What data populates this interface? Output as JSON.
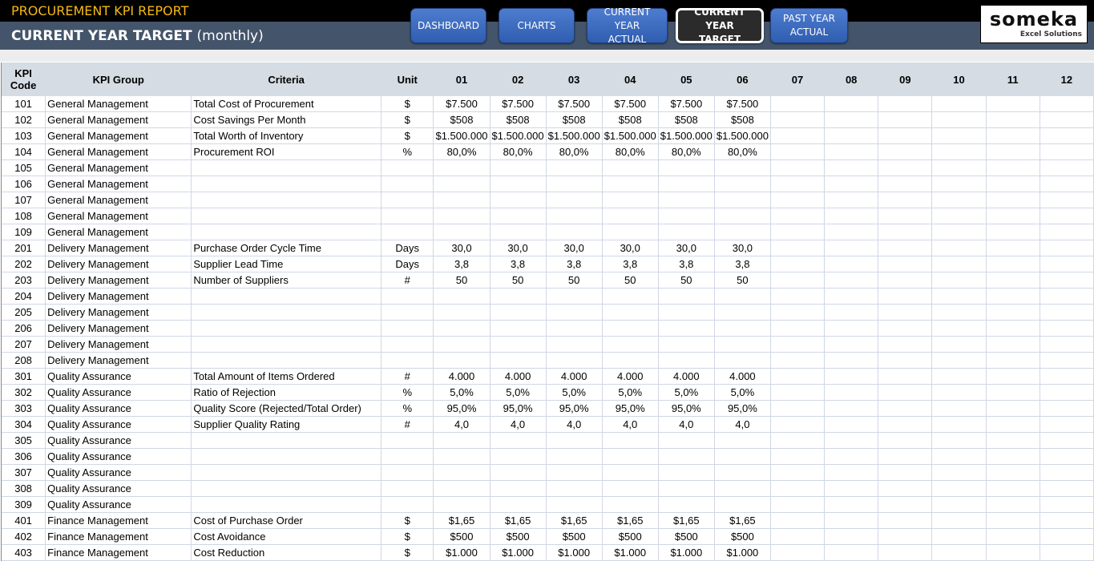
{
  "header": {
    "app_title": "PROCUREMENT KPI REPORT",
    "page_title": "CURRENT YEAR TARGET",
    "page_subtitle": "(monthly)"
  },
  "nav": {
    "dashboard": "DASHBOARD",
    "charts": "CHARTS",
    "current_actual_1": "CURRENT YEAR",
    "current_actual_2": "ACTUAL",
    "current_target_1": "CURRENT YEAR",
    "current_target_2": "TARGET",
    "past_actual_1": "PAST YEAR",
    "past_actual_2": "ACTUAL"
  },
  "logo": {
    "word": "someka",
    "sub": "Excel Solutions"
  },
  "table": {
    "headers": {
      "code_1": "KPI",
      "code_2": "Code",
      "group": "KPI Group",
      "criteria": "Criteria",
      "unit": "Unit",
      "months": [
        "01",
        "02",
        "03",
        "04",
        "05",
        "06",
        "07",
        "08",
        "09",
        "10",
        "11",
        "12"
      ]
    },
    "rows": [
      {
        "code": "101",
        "group": "General Management",
        "criteria": "Total Cost of Procurement",
        "unit": "$",
        "values": [
          "$7.500",
          "$7.500",
          "$7.500",
          "$7.500",
          "$7.500",
          "$7.500",
          "",
          "",
          "",
          "",
          "",
          ""
        ]
      },
      {
        "code": "102",
        "group": "General Management",
        "criteria": "Cost Savings Per Month",
        "unit": "$",
        "values": [
          "$508",
          "$508",
          "$508",
          "$508",
          "$508",
          "$508",
          "",
          "",
          "",
          "",
          "",
          ""
        ]
      },
      {
        "code": "103",
        "group": "General Management",
        "criteria": "Total Worth of Inventory",
        "unit": "$",
        "values": [
          "$1.500.000",
          "$1.500.000",
          "$1.500.000",
          "$1.500.000",
          "$1.500.000",
          "$1.500.000",
          "",
          "",
          "",
          "",
          "",
          ""
        ]
      },
      {
        "code": "104",
        "group": "General Management",
        "criteria": "Procurement ROI",
        "unit": "%",
        "values": [
          "80,0%",
          "80,0%",
          "80,0%",
          "80,0%",
          "80,0%",
          "80,0%",
          "",
          "",
          "",
          "",
          "",
          ""
        ]
      },
      {
        "code": "105",
        "group": "General Management",
        "criteria": "",
        "unit": "",
        "values": [
          "",
          "",
          "",
          "",
          "",
          "",
          "",
          "",
          "",
          "",
          "",
          ""
        ]
      },
      {
        "code": "106",
        "group": "General Management",
        "criteria": "",
        "unit": "",
        "values": [
          "",
          "",
          "",
          "",
          "",
          "",
          "",
          "",
          "",
          "",
          "",
          ""
        ]
      },
      {
        "code": "107",
        "group": "General Management",
        "criteria": "",
        "unit": "",
        "values": [
          "",
          "",
          "",
          "",
          "",
          "",
          "",
          "",
          "",
          "",
          "",
          ""
        ]
      },
      {
        "code": "108",
        "group": "General Management",
        "criteria": "",
        "unit": "",
        "values": [
          "",
          "",
          "",
          "",
          "",
          "",
          "",
          "",
          "",
          "",
          "",
          ""
        ]
      },
      {
        "code": "109",
        "group": "General Management",
        "criteria": "",
        "unit": "",
        "values": [
          "",
          "",
          "",
          "",
          "",
          "",
          "",
          "",
          "",
          "",
          "",
          ""
        ]
      },
      {
        "code": "201",
        "group": "Delivery Management",
        "criteria": "Purchase Order Cycle Time",
        "unit": "Days",
        "values": [
          "30,0",
          "30,0",
          "30,0",
          "30,0",
          "30,0",
          "30,0",
          "",
          "",
          "",
          "",
          "",
          ""
        ]
      },
      {
        "code": "202",
        "group": "Delivery Management",
        "criteria": "Supplier Lead Time",
        "unit": "Days",
        "values": [
          "3,8",
          "3,8",
          "3,8",
          "3,8",
          "3,8",
          "3,8",
          "",
          "",
          "",
          "",
          "",
          ""
        ]
      },
      {
        "code": "203",
        "group": "Delivery Management",
        "criteria": "Number of Suppliers",
        "unit": "#",
        "values": [
          "50",
          "50",
          "50",
          "50",
          "50",
          "50",
          "",
          "",
          "",
          "",
          "",
          ""
        ]
      },
      {
        "code": "204",
        "group": "Delivery Management",
        "criteria": "",
        "unit": "",
        "values": [
          "",
          "",
          "",
          "",
          "",
          "",
          "",
          "",
          "",
          "",
          "",
          ""
        ]
      },
      {
        "code": "205",
        "group": "Delivery Management",
        "criteria": "",
        "unit": "",
        "values": [
          "",
          "",
          "",
          "",
          "",
          "",
          "",
          "",
          "",
          "",
          "",
          ""
        ]
      },
      {
        "code": "206",
        "group": "Delivery Management",
        "criteria": "",
        "unit": "",
        "values": [
          "",
          "",
          "",
          "",
          "",
          "",
          "",
          "",
          "",
          "",
          "",
          ""
        ]
      },
      {
        "code": "207",
        "group": "Delivery Management",
        "criteria": "",
        "unit": "",
        "values": [
          "",
          "",
          "",
          "",
          "",
          "",
          "",
          "",
          "",
          "",
          "",
          ""
        ]
      },
      {
        "code": "208",
        "group": "Delivery Management",
        "criteria": "",
        "unit": "",
        "values": [
          "",
          "",
          "",
          "",
          "",
          "",
          "",
          "",
          "",
          "",
          "",
          ""
        ]
      },
      {
        "code": "301",
        "group": "Quality Assurance",
        "criteria": "Total Amount of Items Ordered",
        "unit": "#",
        "values": [
          "4.000",
          "4.000",
          "4.000",
          "4.000",
          "4.000",
          "4.000",
          "",
          "",
          "",
          "",
          "",
          ""
        ]
      },
      {
        "code": "302",
        "group": "Quality Assurance",
        "criteria": "Ratio of Rejection",
        "unit": "%",
        "values": [
          "5,0%",
          "5,0%",
          "5,0%",
          "5,0%",
          "5,0%",
          "5,0%",
          "",
          "",
          "",
          "",
          "",
          ""
        ]
      },
      {
        "code": "303",
        "group": "Quality Assurance",
        "criteria": "Quality Score (Rejected/Total Order)",
        "unit": "%",
        "values": [
          "95,0%",
          "95,0%",
          "95,0%",
          "95,0%",
          "95,0%",
          "95,0%",
          "",
          "",
          "",
          "",
          "",
          ""
        ]
      },
      {
        "code": "304",
        "group": "Quality Assurance",
        "criteria": "Supplier Quality Rating",
        "unit": "#",
        "values": [
          "4,0",
          "4,0",
          "4,0",
          "4,0",
          "4,0",
          "4,0",
          "",
          "",
          "",
          "",
          "",
          ""
        ]
      },
      {
        "code": "305",
        "group": "Quality Assurance",
        "criteria": "",
        "unit": "",
        "values": [
          "",
          "",
          "",
          "",
          "",
          "",
          "",
          "",
          "",
          "",
          "",
          ""
        ]
      },
      {
        "code": "306",
        "group": "Quality Assurance",
        "criteria": "",
        "unit": "",
        "values": [
          "",
          "",
          "",
          "",
          "",
          "",
          "",
          "",
          "",
          "",
          "",
          ""
        ]
      },
      {
        "code": "307",
        "group": "Quality Assurance",
        "criteria": "",
        "unit": "",
        "values": [
          "",
          "",
          "",
          "",
          "",
          "",
          "",
          "",
          "",
          "",
          "",
          ""
        ]
      },
      {
        "code": "308",
        "group": "Quality Assurance",
        "criteria": "",
        "unit": "",
        "values": [
          "",
          "",
          "",
          "",
          "",
          "",
          "",
          "",
          "",
          "",
          "",
          ""
        ]
      },
      {
        "code": "309",
        "group": "Quality Assurance",
        "criteria": "",
        "unit": "",
        "values": [
          "",
          "",
          "",
          "",
          "",
          "",
          "",
          "",
          "",
          "",
          "",
          ""
        ]
      },
      {
        "code": "401",
        "group": "Finance Management",
        "criteria": "Cost of Purchase Order",
        "unit": "$",
        "values": [
          "$1,65",
          "$1,65",
          "$1,65",
          "$1,65",
          "$1,65",
          "$1,65",
          "",
          "",
          "",
          "",
          "",
          ""
        ]
      },
      {
        "code": "402",
        "group": "Finance Management",
        "criteria": "Cost Avoidance",
        "unit": "$",
        "values": [
          "$500",
          "$500",
          "$500",
          "$500",
          "$500",
          "$500",
          "",
          "",
          "",
          "",
          "",
          ""
        ]
      },
      {
        "code": "403",
        "group": "Finance Management",
        "criteria": "Cost Reduction",
        "unit": "$",
        "values": [
          "$1.000",
          "$1.000",
          "$1.000",
          "$1.000",
          "$1.000",
          "$1.000",
          "",
          "",
          "",
          "",
          "",
          ""
        ]
      }
    ]
  }
}
